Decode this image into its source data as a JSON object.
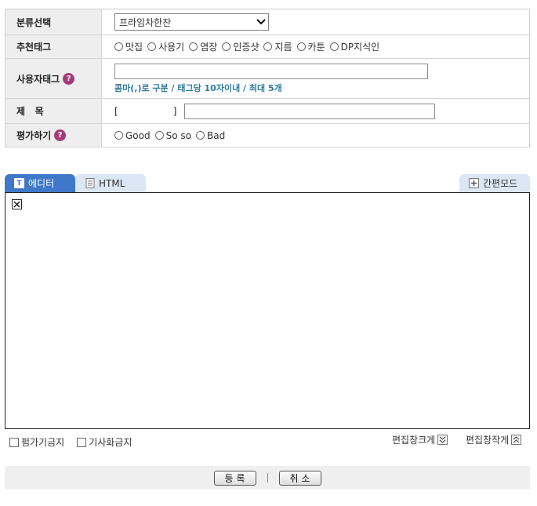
{
  "form": {
    "category": {
      "label": "분류선택",
      "selected": "프라임차한잔"
    },
    "recommend_tag": {
      "label": "추천태그",
      "options": [
        "맛집",
        "사용기",
        "염장",
        "인증샷",
        "지름",
        "카툰",
        "DP지식인"
      ]
    },
    "user_tag": {
      "label": "사용자태그",
      "value": "",
      "hint": "콤마(,)로 구분 / 태그당 10자이내 / 최대 5개"
    },
    "title": {
      "label": "제   목",
      "bracket_open": "[",
      "bracket_close": "]",
      "value": ""
    },
    "rating": {
      "label": "평가하기",
      "options": [
        "Good",
        "So so",
        "Bad"
      ]
    }
  },
  "editor": {
    "tabs": {
      "editor": "에디터",
      "html": "HTML",
      "easy_mode": "간편모드"
    },
    "content": ""
  },
  "options": {
    "no_rating": "펌가기금지",
    "no_article": "기사화금지",
    "enlarge": "편집창크게",
    "shrink": "편집창작게"
  },
  "actions": {
    "submit": "등 록",
    "cancel": "취 소"
  },
  "icons": {
    "help": "question-mark-icon",
    "editor_tab": "text-t-icon",
    "html_tab": "document-icon",
    "easy_mode": "plus-box-icon",
    "enlarge": "chevron-down-double-icon",
    "shrink": "chevron-up-double-icon"
  },
  "colors": {
    "active_tab": "#3f78c8",
    "inactive_tab": "#dce7f5",
    "hint": "#2f7aa0",
    "help_icon": "#a53a78",
    "label_bg": "#eeeeee"
  }
}
